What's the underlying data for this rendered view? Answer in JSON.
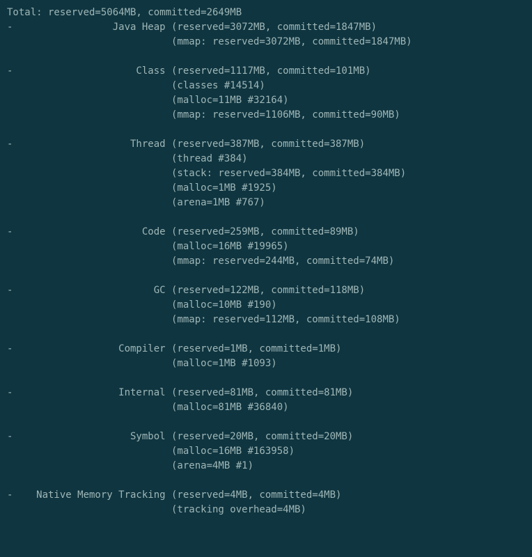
{
  "total": {
    "reserved": "5064MB",
    "committed": "2649MB"
  },
  "sections": [
    {
      "name": "Java Heap",
      "head": {
        "reserved": "3072MB",
        "committed": "1847MB"
      },
      "details": [
        "(mmap: reserved=3072MB, committed=1847MB)"
      ]
    },
    {
      "name": "Class",
      "head": {
        "reserved": "1117MB",
        "committed": "101MB"
      },
      "details": [
        "(classes #14514)",
        "(malloc=11MB #32164)",
        "(mmap: reserved=1106MB, committed=90MB)"
      ]
    },
    {
      "name": "Thread",
      "head": {
        "reserved": "387MB",
        "committed": "387MB"
      },
      "details": [
        "(thread #384)",
        "(stack: reserved=384MB, committed=384MB)",
        "(malloc=1MB #1925)",
        "(arena=1MB #767)"
      ]
    },
    {
      "name": "Code",
      "head": {
        "reserved": "259MB",
        "committed": "89MB"
      },
      "details": [
        "(malloc=16MB #19965)",
        "(mmap: reserved=244MB, committed=74MB)"
      ]
    },
    {
      "name": "GC",
      "head": {
        "reserved": "122MB",
        "committed": "118MB"
      },
      "details": [
        "(malloc=10MB #190)",
        "(mmap: reserved=112MB, committed=108MB)"
      ]
    },
    {
      "name": "Compiler",
      "head": {
        "reserved": "1MB",
        "committed": "1MB"
      },
      "details": [
        "(malloc=1MB #1093)"
      ]
    },
    {
      "name": "Internal",
      "head": {
        "reserved": "81MB",
        "committed": "81MB"
      },
      "details": [
        "(malloc=81MB #36840)"
      ]
    },
    {
      "name": "Symbol",
      "head": {
        "reserved": "20MB",
        "committed": "20MB"
      },
      "details": [
        "(malloc=16MB #163958)",
        "(arena=4MB #1)"
      ]
    },
    {
      "name": "Native Memory Tracking",
      "head": {
        "reserved": "4MB",
        "committed": "4MB"
      },
      "details": [
        "(tracking overhead=4MB)"
      ]
    }
  ]
}
